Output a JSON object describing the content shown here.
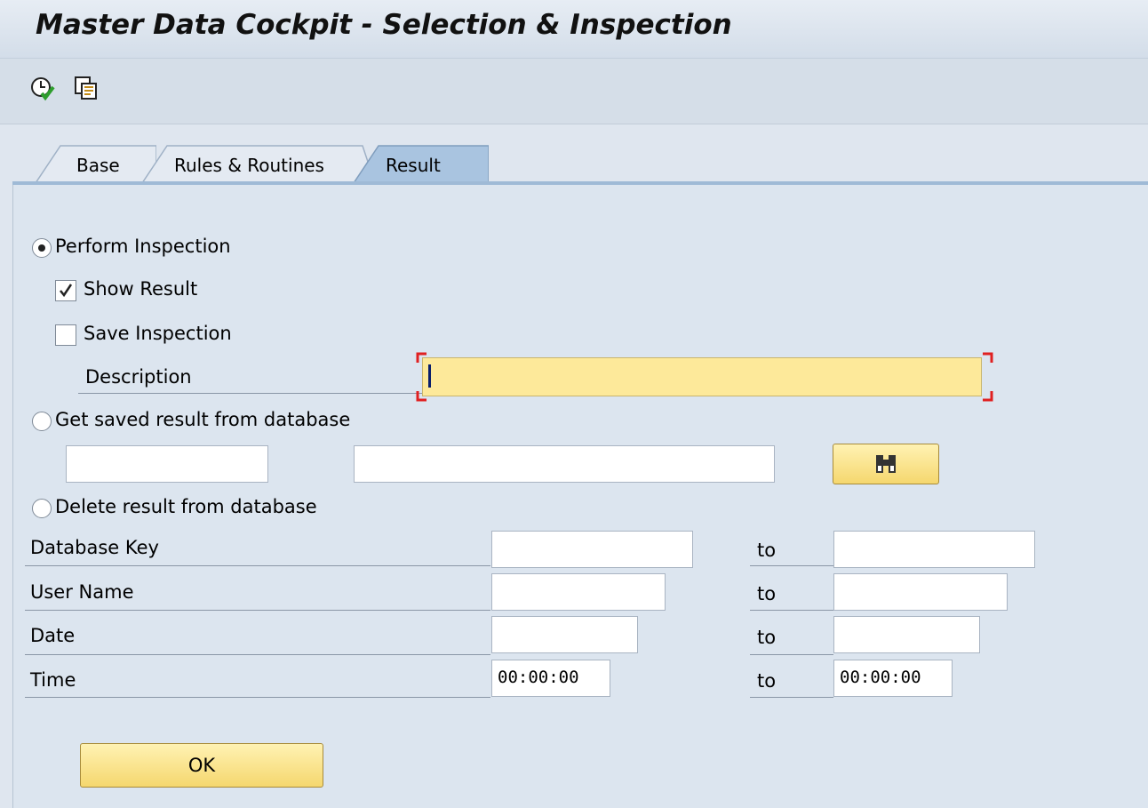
{
  "window": {
    "title": "Master Data Cockpit - Selection & Inspection"
  },
  "toolbar": {
    "icons": [
      "execute-clock-icon",
      "copy-icon"
    ]
  },
  "tabs": [
    {
      "label": "Base",
      "active": false
    },
    {
      "label": "Rules & Routines",
      "active": false
    },
    {
      "label": "Result",
      "active": true
    }
  ],
  "result": {
    "perform_inspection": {
      "label": "Perform Inspection",
      "selected": true
    },
    "show_result": {
      "label": "Show Result",
      "checked": true
    },
    "save_inspection": {
      "label": "Save Inspection",
      "checked": false
    },
    "description": {
      "label": "Description",
      "value": ""
    },
    "get_saved": {
      "label": "Get saved result from database",
      "selected": false
    },
    "get_saved_fields": {
      "field1": "",
      "field2": ""
    },
    "search_icon": "binoculars-icon",
    "delete_result": {
      "label": "Delete result from database",
      "selected": false
    },
    "range_rows": [
      {
        "label": "Database Key",
        "from": "",
        "to_label": "to",
        "to": ""
      },
      {
        "label": "User Name",
        "from": "",
        "to_label": "to",
        "to": ""
      },
      {
        "label": "Date",
        "from": "",
        "to_label": "to",
        "to": ""
      },
      {
        "label": "Time",
        "from": "00:00:00",
        "to_label": "to",
        "to": "00:00:00"
      }
    ],
    "ok_button": "OK"
  },
  "colors": {
    "required_field_bg": "#fde99a",
    "required_marker": "#e02020",
    "button_bg": "#f5d76e",
    "active_tab": "#a9c4e0"
  }
}
